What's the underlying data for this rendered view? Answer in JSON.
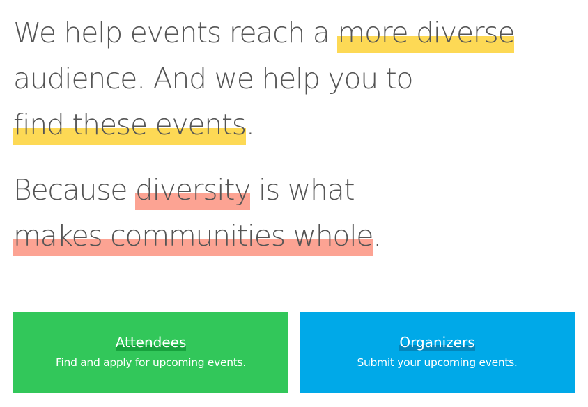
{
  "hero": {
    "line1_pre": "We help events reach a ",
    "line1_hl": "more diverse",
    "line2": "audience. And we help you to",
    "line3_hl": "find these events",
    "line3_post": ".",
    "line4_pre": "Because ",
    "line4_hl": "diversity",
    "line4_post": " is what",
    "line5_hl": "makes communities whole",
    "line5_post": "."
  },
  "cards": [
    {
      "title": "Attendees",
      "subtitle": "Find and apply for upcoming events.",
      "color": "#32c75a"
    },
    {
      "title": "Organizers",
      "subtitle": "Submit your upcoming events.",
      "color": "#00a9e8"
    }
  ],
  "colors": {
    "highlight_yellow": "#fdd955",
    "highlight_salmon": "#fca393",
    "text": "#555555"
  }
}
